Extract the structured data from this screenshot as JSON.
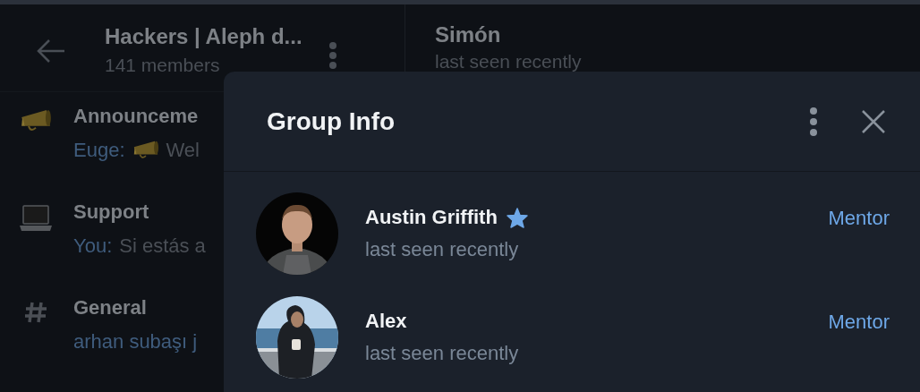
{
  "chat_list": {
    "header": {
      "title": "Hackers | Aleph d...",
      "subtitle": "141 members"
    },
    "items": [
      {
        "title": "Announceme",
        "sender": "Euge:",
        "preview_emoji": true,
        "preview": "Wel"
      },
      {
        "title": "Support",
        "sender": "You:",
        "preview_emoji": false,
        "preview": "Si estás a"
      },
      {
        "title": "General",
        "sender": "arhan subaşı j",
        "preview_emoji": false
      }
    ]
  },
  "chat": {
    "header": {
      "title": "Simón",
      "subtitle": "last seen recently"
    }
  },
  "dialog": {
    "title": "Group Info",
    "members": [
      {
        "name": "Austin Griffith",
        "owner": true,
        "status": "last seen recently",
        "role": "Mentor"
      },
      {
        "name": "Alex",
        "owner": false,
        "status": "last seen recently",
        "role": "Mentor"
      }
    ]
  }
}
